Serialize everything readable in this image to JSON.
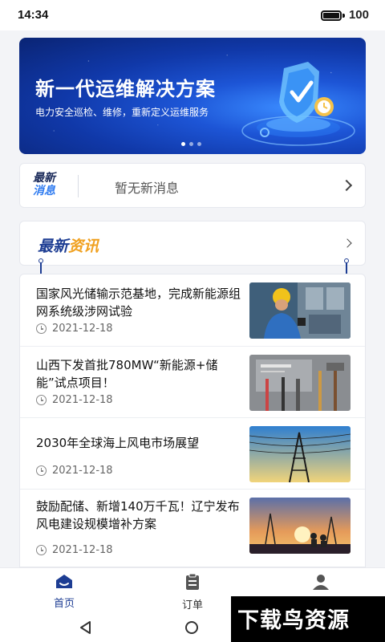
{
  "status_bar": {
    "time": "14:34",
    "battery": "100"
  },
  "banner": {
    "title": "新一代运维解决方案",
    "subtitle": "电力安全巡检、维修，重新定义运维服务",
    "slides": 3,
    "active_slide": 1
  },
  "notice": {
    "logo_line1": "最新",
    "logo_line2": "消息",
    "text": "暂无新消息"
  },
  "news_header": {
    "title_part1": "最新",
    "title_part2": "资讯"
  },
  "news": [
    {
      "title": "国家风光储输示范基地，完成新能源组网系统级涉网试验",
      "date": "2021-12-18",
      "thumb": "electrician-panel"
    },
    {
      "title": "山西下发首批780MW“新能源+储能”试点项目！",
      "date": "2021-12-18",
      "thumb": "tools"
    },
    {
      "title": "2030年全球海上风电市场展望",
      "date": "2021-12-18",
      "thumb": "power-tower"
    },
    {
      "title": "鼓励配储、新增140万千瓦！辽宁发布风电建设规模增补方案",
      "date": "2021-12-18",
      "thumb": "sunset-workers"
    }
  ],
  "bottom_nav": [
    {
      "label": "首页",
      "icon": "home-icon",
      "active": true
    },
    {
      "label": "订单",
      "icon": "clipboard-icon",
      "active": false
    },
    {
      "label": "我的",
      "icon": "user-icon",
      "active": false
    }
  ],
  "watermark": "下载鸟资源",
  "colors": {
    "primary": "#1d3d93",
    "accent": "#f0a01e",
    "link_blue": "#2f7bf0"
  }
}
